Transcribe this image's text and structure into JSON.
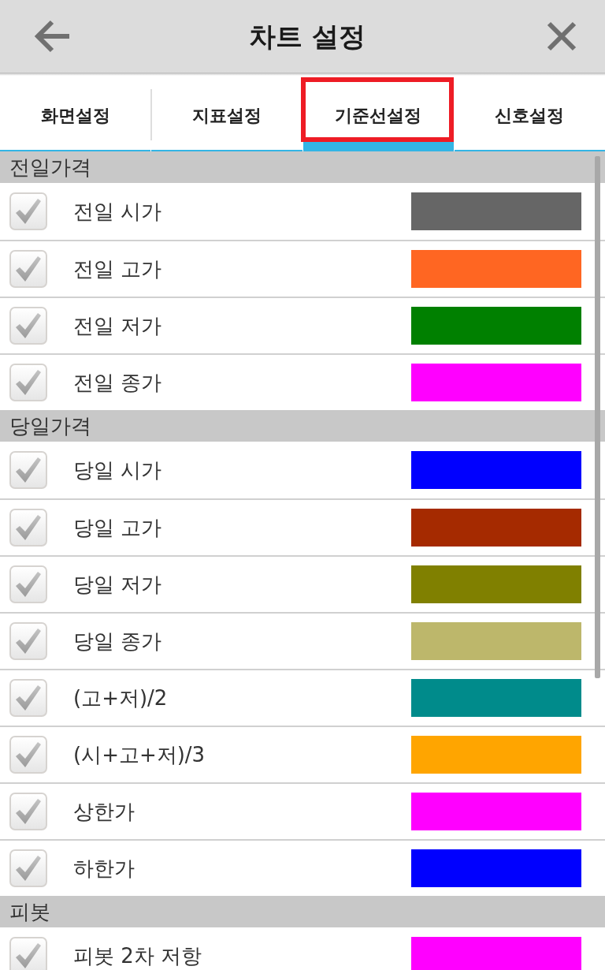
{
  "header": {
    "title": "차트 설정"
  },
  "tabs": [
    {
      "label": "화면설정",
      "selected": false,
      "highlighted": false
    },
    {
      "label": "지표설정",
      "selected": false,
      "highlighted": false
    },
    {
      "label": "기준선설정",
      "selected": true,
      "highlighted": true
    },
    {
      "label": "신호설정",
      "selected": false,
      "highlighted": false
    }
  ],
  "sections": [
    {
      "title": "전일가격",
      "items": [
        {
          "label": "전일 시가",
          "checked": true,
          "color": "#666666"
        },
        {
          "label": "전일 고가",
          "checked": true,
          "color": "#ff6622"
        },
        {
          "label": "전일 저가",
          "checked": true,
          "color": "#008000"
        },
        {
          "label": "전일 종가",
          "checked": true,
          "color": "#ff00ff"
        }
      ]
    },
    {
      "title": "당일가격",
      "items": [
        {
          "label": "당일 시가",
          "checked": true,
          "color": "#0000ff"
        },
        {
          "label": "당일 고가",
          "checked": true,
          "color": "#a52a00"
        },
        {
          "label": "당일 저가",
          "checked": true,
          "color": "#808000"
        },
        {
          "label": "당일 종가",
          "checked": true,
          "color": "#bdb76b"
        },
        {
          "label": "(고+저)/2",
          "checked": true,
          "color": "#008b8b"
        },
        {
          "label": "(시+고+저)/3",
          "checked": true,
          "color": "#ffa500"
        },
        {
          "label": "상한가",
          "checked": true,
          "color": "#ff00ff"
        },
        {
          "label": "하한가",
          "checked": true,
          "color": "#0000ff"
        }
      ]
    },
    {
      "title": "피봇",
      "items": [
        {
          "label": "피봇 2차 저항",
          "checked": true,
          "color": "#ff00ff"
        }
      ]
    }
  ]
}
